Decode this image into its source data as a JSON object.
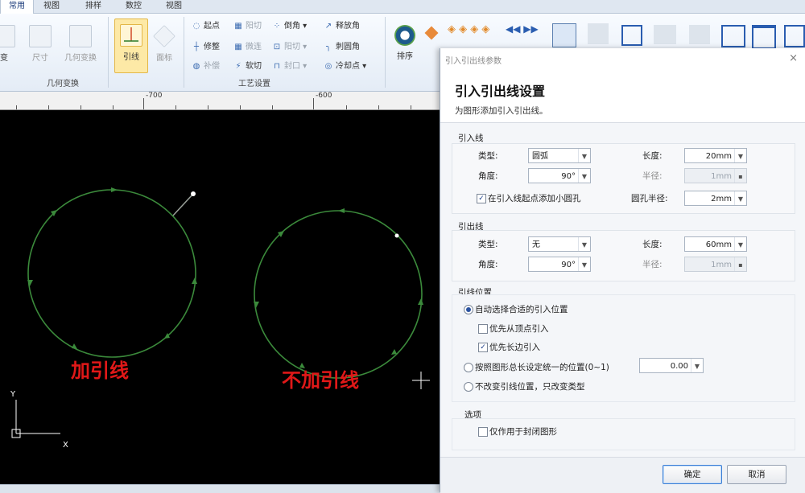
{
  "tabs": [
    "常用",
    "视图",
    "排样",
    "数控",
    "视图"
  ],
  "ribbon": {
    "left_buttons": [
      {
        "label": "变",
        "icon": "transform-icon"
      },
      {
        "label": "尺寸",
        "icon": "size-icon"
      },
      {
        "label": "几何变换",
        "icon": "geometry-transform-icon"
      },
      {
        "label": "引线",
        "icon": "lead-line-icon"
      },
      {
        "label": "面标",
        "icon": "face-mark-icon"
      }
    ],
    "small_col1": [
      "起点",
      "修整",
      "补偿"
    ],
    "small_col2": [
      "阳切",
      "微连",
      "软切"
    ],
    "small_col3": [
      "倒角",
      "阳切",
      "封口"
    ],
    "small_col4": [
      "释放角",
      "刺圆角",
      "冷却点"
    ],
    "group_labels": [
      "几何变换",
      "工艺设置"
    ],
    "sort_label": "排序"
  },
  "ruler": {
    "labels": [
      "-700",
      "-600"
    ]
  },
  "canvas": {
    "label_with": "加引线",
    "label_without": "不加引线",
    "axis_y": "Y",
    "axis_x": "X"
  },
  "dialog": {
    "window_title": "引入引出线参数",
    "heading": "引入引出线设置",
    "subtitle": "为图形添加引入引出线。",
    "lead_in": {
      "title": "引入线",
      "type_label": "类型:",
      "type_value": "圆弧",
      "length_label": "长度:",
      "length_value": "20mm",
      "angle_label": "角度:",
      "angle_value": "90°",
      "radius_label": "半径:",
      "radius_value": "1mm",
      "hole_check_label": "在引入线起点添加小圆孔",
      "hole_radius_label": "圆孔半径:",
      "hole_radius_value": "2mm"
    },
    "lead_out": {
      "title": "引出线",
      "type_label": "类型:",
      "type_value": "无",
      "length_label": "长度:",
      "length_value": "60mm",
      "angle_label": "角度:",
      "angle_value": "90°",
      "radius_label": "半径:",
      "radius_value": "1mm"
    },
    "position": {
      "title": "引线位置",
      "auto_label": "自动选择合适的引入位置",
      "prefer_vertex_label": "优先从顶点引入",
      "prefer_long_edge_label": "优先长边引入",
      "ratio_label": "按照图形总长设定统一的位置(0~1)",
      "ratio_value": "0.00",
      "keep_label": "不改变引线位置，只改变类型"
    },
    "options": {
      "title": "选项",
      "closed_only_label": "仅作用于封闭图形"
    },
    "ok_label": "确定",
    "cancel_label": "取消"
  },
  "colors": {
    "curve": "#3b8a3b",
    "label_red": "#e01818"
  }
}
